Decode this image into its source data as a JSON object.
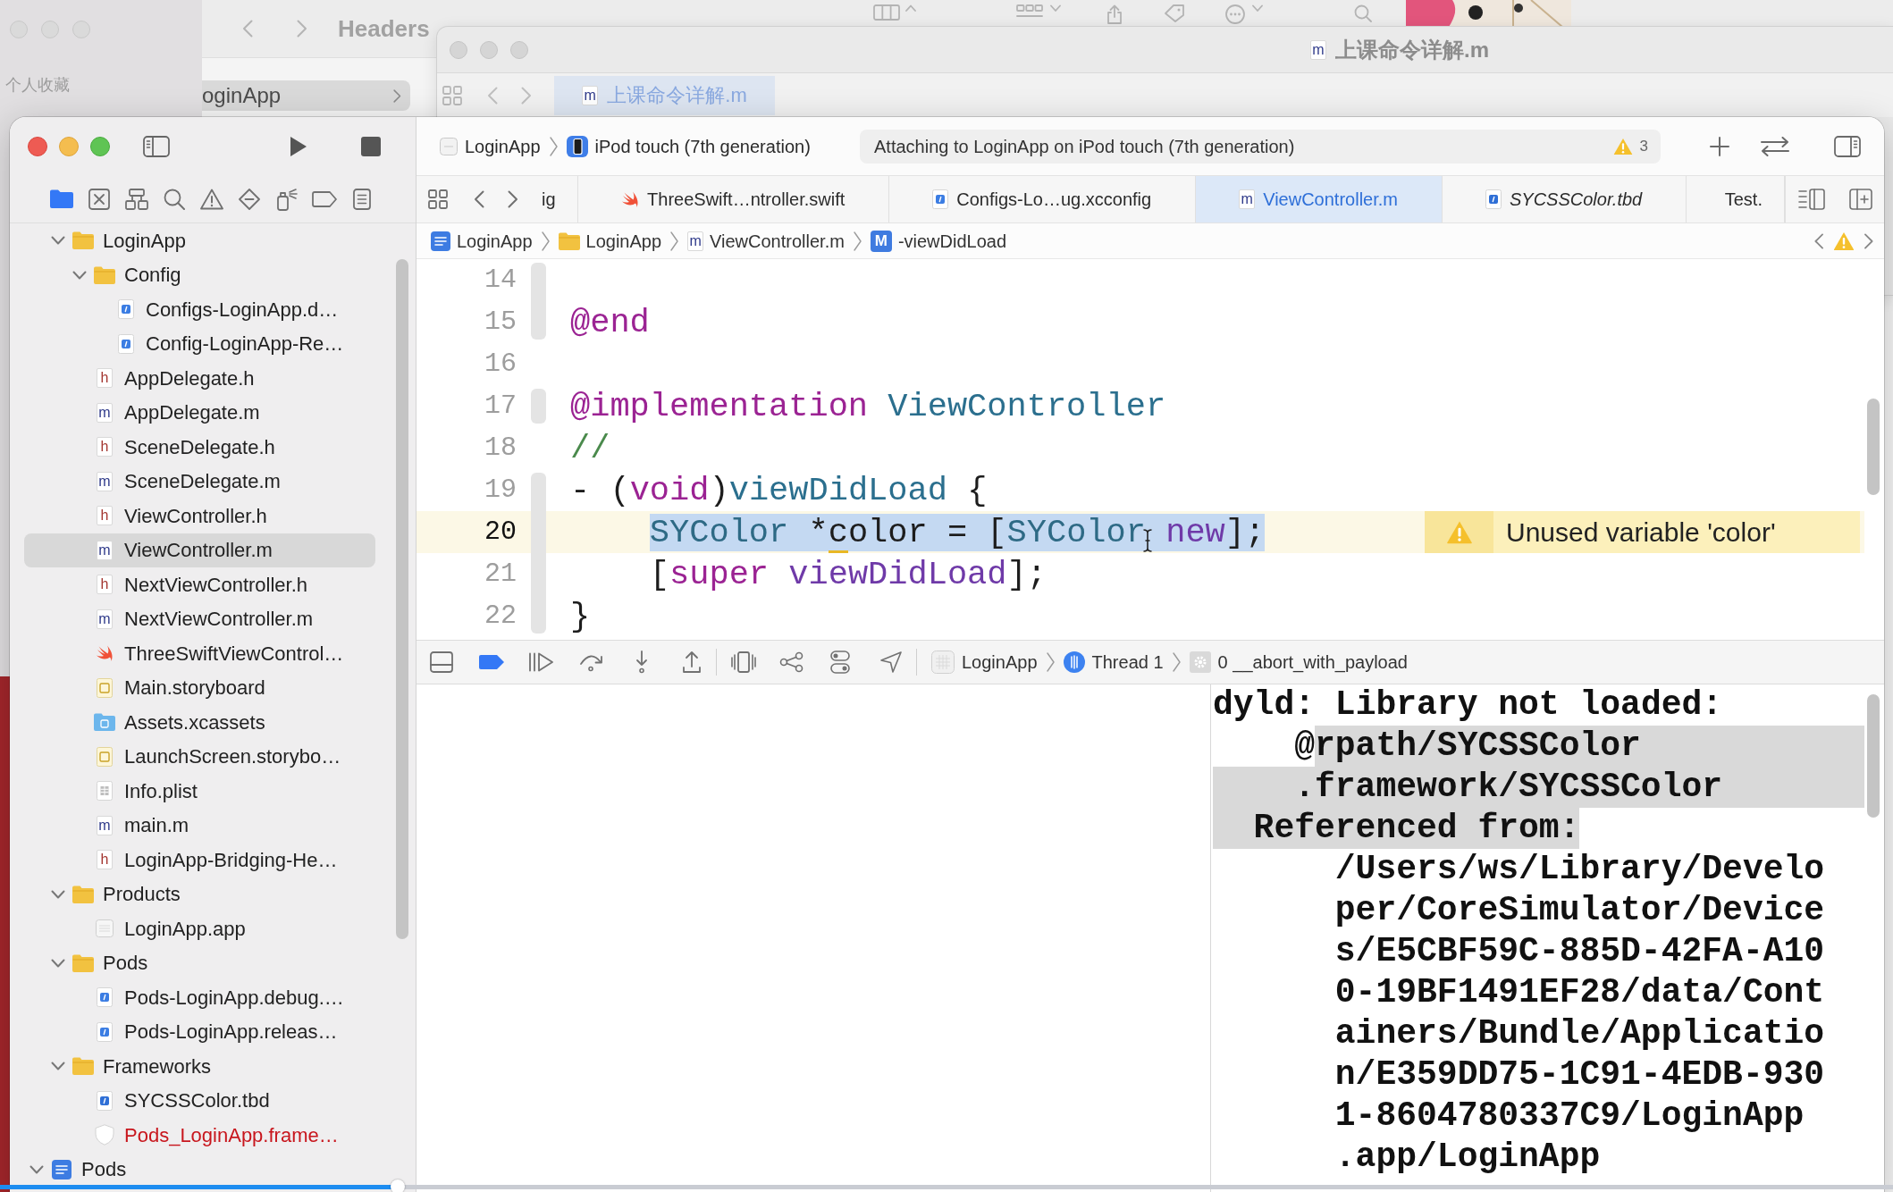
{
  "desktop": {
    "finder": {
      "title": "Headers",
      "sidebar_heading": "个人收藏",
      "column_item": {
        "label": "oginApp",
        "selected": true
      }
    },
    "back_window": {
      "title": "上课命令详解.m",
      "title_icon_text": "m",
      "tab": {
        "label": "上课命令详解.m",
        "icon_text": "m",
        "selected": true
      }
    }
  },
  "xcode": {
    "toolbar": {
      "scheme": "LoginApp",
      "device": "iPod touch (7th generation)",
      "activity": "Attaching to LoginApp on iPod touch (7th generation)",
      "warning_count": "3"
    },
    "navigator_tabs": [
      {
        "kind": "project",
        "selected": true
      },
      {
        "kind": "source-control",
        "selected": false
      },
      {
        "kind": "symbols",
        "selected": false
      },
      {
        "kind": "find",
        "selected": false
      },
      {
        "kind": "issues",
        "selected": false
      },
      {
        "kind": "tests",
        "selected": false
      },
      {
        "kind": "debug",
        "selected": false
      },
      {
        "kind": "breakpoints",
        "selected": false
      },
      {
        "kind": "reports",
        "selected": false
      }
    ],
    "file_tree": [
      {
        "children": [
          {
            "label": "LoginApp",
            "kind": "folder",
            "expanded": true,
            "selected": false,
            "missing": false,
            "children": [
              {
                "label": "Config",
                "kind": "folder",
                "expanded": true,
                "selected": false,
                "missing": false,
                "children": [
                  {
                    "label": "Configs-LoginApp.d…",
                    "kind": "config",
                    "selected": false,
                    "missing": false
                  },
                  {
                    "label": "Config-LoginApp-Re…",
                    "kind": "config",
                    "selected": false,
                    "missing": false
                  }
                ]
              },
              {
                "label": "AppDelegate.h",
                "kind": "header",
                "icon_text": "h",
                "selected": false,
                "missing": false
              },
              {
                "label": "AppDelegate.m",
                "kind": "source",
                "icon_text": "m",
                "selected": false,
                "missing": false
              },
              {
                "label": "SceneDelegate.h",
                "kind": "header",
                "icon_text": "h",
                "selected": false,
                "missing": false
              },
              {
                "label": "SceneDelegate.m",
                "kind": "source",
                "icon_text": "m",
                "selected": false,
                "missing": false
              },
              {
                "label": "ViewController.h",
                "kind": "header",
                "icon_text": "h",
                "selected": false,
                "missing": false
              },
              {
                "label": "ViewController.m",
                "kind": "source",
                "icon_text": "m",
                "selected": true,
                "missing": false
              },
              {
                "label": "NextViewController.h",
                "kind": "header",
                "icon_text": "h",
                "selected": false,
                "missing": false
              },
              {
                "label": "NextViewController.m",
                "kind": "source",
                "icon_text": "m",
                "selected": false,
                "missing": false
              },
              {
                "label": "ThreeSwiftViewControl…",
                "kind": "swift",
                "selected": false,
                "missing": false
              },
              {
                "label": "Main.storyboard",
                "kind": "storyboard",
                "selected": false,
                "missing": false
              },
              {
                "label": "Assets.xcassets",
                "kind": "assets",
                "selected": false,
                "missing": false
              },
              {
                "label": "LaunchScreen.storybo…",
                "kind": "storyboard",
                "selected": false,
                "missing": false
              },
              {
                "label": "Info.plist",
                "kind": "plist",
                "selected": false,
                "missing": false
              },
              {
                "label": "main.m",
                "kind": "source",
                "icon_text": "m",
                "selected": false,
                "missing": false
              },
              {
                "label": "LoginApp-Bridging-He…",
                "kind": "header",
                "icon_text": "h",
                "selected": false,
                "missing": false
              }
            ]
          },
          {
            "label": "Products",
            "kind": "folder",
            "expanded": true,
            "selected": false,
            "missing": false,
            "children": [
              {
                "label": "LoginApp.app",
                "kind": "app",
                "selected": false,
                "missing": false
              }
            ]
          },
          {
            "label": "Pods",
            "kind": "folder",
            "expanded": true,
            "selected": false,
            "missing": false,
            "children": [
              {
                "label": "Pods-LoginApp.debug.…",
                "kind": "config",
                "selected": false,
                "missing": false
              },
              {
                "label": "Pods-LoginApp.releas…",
                "kind": "config",
                "selected": false,
                "missing": false
              }
            ]
          },
          {
            "label": "Frameworks",
            "kind": "folder",
            "expanded": true,
            "selected": false,
            "missing": false,
            "children": [
              {
                "label": "SYCSSColor.tbd",
                "kind": "tbd",
                "selected": false,
                "missing": false
              },
              {
                "label": "Pods_LoginApp.frame…",
                "kind": "framework",
                "selected": false,
                "missing": true
              }
            ]
          }
        ]
      },
      {
        "label": "Pods",
        "kind": "project",
        "expanded": true,
        "selected": false,
        "missing": false
      }
    ],
    "tabs": [
      {
        "label": "ig",
        "selected": false,
        "preview": false
      },
      {
        "label": "ThreeSwift…ntroller.swift",
        "kind": "swift",
        "selected": false,
        "preview": false
      },
      {
        "label": "Configs-Lo…ug.xcconfig",
        "kind": "config",
        "selected": false,
        "preview": false
      },
      {
        "label": "ViewController.m",
        "kind": "source",
        "icon_text": "m",
        "selected": true,
        "preview": false
      },
      {
        "label": "SYCSSColor.tbd",
        "kind": "tbd",
        "selected": false,
        "preview": true
      },
      {
        "label": "Test.",
        "kind": "config",
        "selected": false,
        "preview": false
      }
    ],
    "jump_bar": [
      {
        "label": "LoginApp",
        "kind": "project"
      },
      {
        "label": "LoginApp",
        "kind": "folder"
      },
      {
        "label": "ViewController.m",
        "kind": "source",
        "icon_text": "m"
      },
      {
        "label": "-viewDidLoad",
        "kind": "method",
        "icon_text": "M"
      }
    ],
    "editor": {
      "lines": [
        {
          "number": "14",
          "current": false,
          "ribbon": true
        },
        {
          "number": "15",
          "current": false,
          "ribbon": true,
          "selected": false,
          "tokens": [
            {
              "text": "@end",
              "kind": "keyword"
            }
          ]
        },
        {
          "number": "16",
          "current": false,
          "ribbon": false
        },
        {
          "number": "17",
          "current": false,
          "ribbon": true,
          "selected": false,
          "tokens": [
            {
              "text": "@implementation ",
              "kind": "keyword"
            },
            {
              "text": "ViewController",
              "kind": "declaration"
            }
          ]
        },
        {
          "number": "18",
          "current": false,
          "ribbon": false,
          "selected": false,
          "tokens": [
            {
              "text": "//",
              "kind": "comment"
            }
          ]
        },
        {
          "number": "19",
          "current": false,
          "ribbon": true,
          "selected": false,
          "tokens": [
            {
              "text": "- (",
              "kind": "plain"
            },
            {
              "text": "void",
              "kind": "keyword"
            },
            {
              "text": ")",
              "kind": "plain"
            },
            {
              "text": "viewDidLoad",
              "kind": "declaration"
            },
            {
              "text": " {",
              "kind": "plain"
            }
          ]
        },
        {
          "number": "20",
          "current": true,
          "ribbon": true,
          "selected": true,
          "tokens": [
            {
              "text": "    SYColor",
              "kind": "type"
            },
            {
              "text": " *",
              "kind": "plain"
            },
            {
              "text": "color",
              "kind": "plain",
              "warning": true
            },
            {
              "text": " = [",
              "kind": "plain"
            },
            {
              "text": "SYColor ",
              "kind": "type"
            },
            {
              "text": "new",
              "kind": "method"
            },
            {
              "text": "];",
              "kind": "plain"
            }
          ],
          "annotation": {
            "kind": "warning",
            "message": "Unused variable 'color'"
          }
        },
        {
          "number": "21",
          "current": false,
          "ribbon": true,
          "selected": false,
          "tokens": [
            {
              "text": "    [",
              "kind": "plain"
            },
            {
              "text": "super ",
              "kind": "keyword"
            },
            {
              "text": "viewDidLoad",
              "kind": "method"
            },
            {
              "text": "];",
              "kind": "plain"
            }
          ]
        },
        {
          "number": "22",
          "current": false,
          "ribbon": true,
          "selected": false,
          "tokens": [
            {
              "text": "}",
              "kind": "plain"
            }
          ]
        }
      ]
    },
    "debug_bar": {
      "breakpoints_active": true,
      "process": "LoginApp",
      "thread": "Thread 1",
      "frame": "0 __abort_with_payload"
    },
    "console": {
      "lines": [
        {
          "kind": "message",
          "segments": [
            {
              "text": "dyld: Library not loaded:",
              "selected": false
            }
          ]
        },
        {
          "kind": "wrapped",
          "segments": [
            {
              "text": "@",
              "selected": false
            },
            {
              "text": "rpath/SYCSSColor",
              "selected": true
            }
          ]
        },
        {
          "kind": "wrapped",
          "segments": [
            {
              "text": ".framework/SYCSSColor",
              "selected": true
            }
          ]
        },
        {
          "kind": "detail",
          "segments": [
            {
              "text": "Referenced from:",
              "selected": true
            }
          ]
        },
        {
          "kind": "path",
          "segments": [
            {
              "text": "/Users/ws/Library/Develo",
              "selected": false
            }
          ]
        },
        {
          "kind": "path",
          "segments": [
            {
              "text": "per/CoreSimulator/Device",
              "selected": false
            }
          ]
        },
        {
          "kind": "path",
          "segments": [
            {
              "text": "s/E5CBF59C-885D-42FA-A10",
              "selected": false
            }
          ]
        },
        {
          "kind": "path",
          "segments": [
            {
              "text": "0-19BF1491EF28/data/Cont",
              "selected": false
            }
          ]
        },
        {
          "kind": "path",
          "segments": [
            {
              "text": "ainers/Bundle/Applicatio",
              "selected": false
            }
          ]
        },
        {
          "kind": "path",
          "segments": [
            {
              "text": "n/E359DD75-1C91-4EDB-930",
              "selected": false
            }
          ]
        },
        {
          "kind": "path",
          "segments": [
            {
              "text": "1-8604780337C9/LoginApp",
              "selected": false
            }
          ]
        },
        {
          "kind": "path",
          "segments": [
            {
              "text": ".app/LoginApp",
              "selected": false
            }
          ]
        }
      ]
    }
  },
  "video_player": {
    "progress": {
      "level": 0.21
    }
  }
}
